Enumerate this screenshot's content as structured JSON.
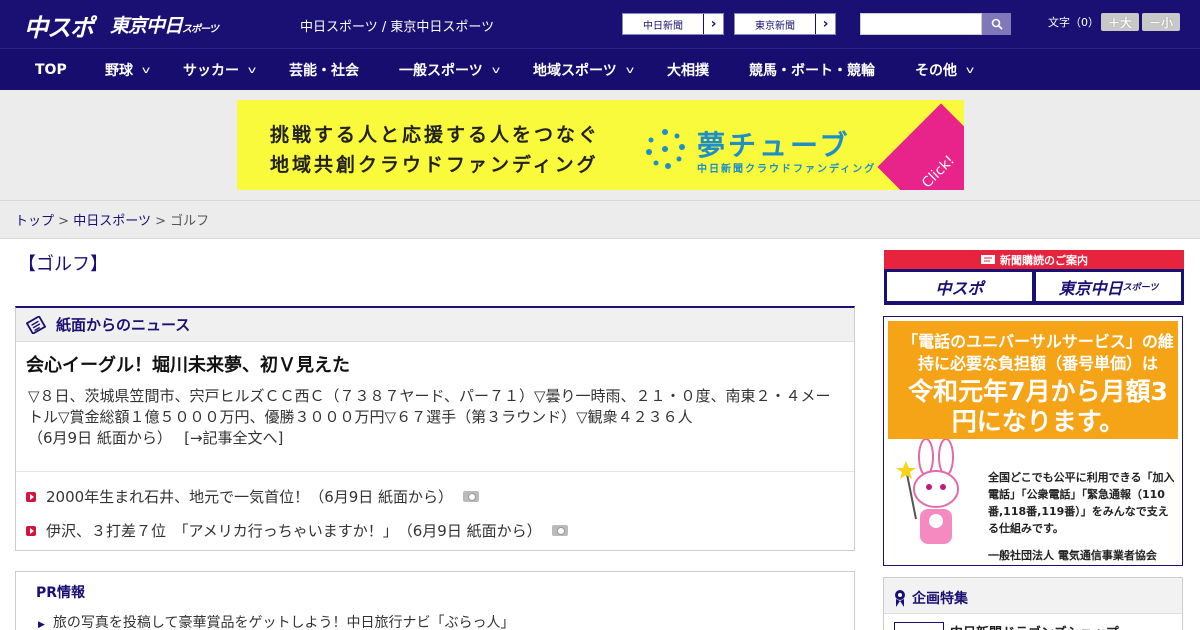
{
  "header": {
    "logo_main": "中スポ",
    "logo_tokyo": "東京中日",
    "logo_tokyo_small": "スポーツ",
    "site_link": "中日スポーツ / 東京中日スポーツ",
    "paper_links": [
      "中日新聞",
      "東京新聞"
    ],
    "search_placeholder": "",
    "font_size_label": "文字（0）",
    "font_bigger": "＋大",
    "font_smaller": "－小"
  },
  "nav": {
    "items": [
      {
        "label": "TOP",
        "has_menu": false
      },
      {
        "label": "野球",
        "has_menu": true
      },
      {
        "label": "サッカー",
        "has_menu": true
      },
      {
        "label": "芸能・社会",
        "has_menu": false
      },
      {
        "label": "一般スポーツ",
        "has_menu": true
      },
      {
        "label": "地域スポーツ",
        "has_menu": true
      },
      {
        "label": "大相撲",
        "has_menu": false
      },
      {
        "label": "競馬・ボート・競輪",
        "has_menu": false
      },
      {
        "label": "その他",
        "has_menu": true
      }
    ]
  },
  "banner": {
    "line1": "挑戦する人と応援する人をつなぐ",
    "line2": "地域共創クラウドファンディング",
    "brand": "夢チューブ",
    "brand_sub": "中日新聞クラウドファンディング",
    "click": "Click!"
  },
  "breadcrumb": {
    "top": "トップ",
    "section": "中日スポーツ",
    "current": "ゴルフ",
    "sep": ">"
  },
  "page": {
    "title": "【ゴルフ】"
  },
  "news": {
    "header": "紙面からのニュース",
    "lead_title": "会心イーグル！堀川未来夢、初Ｖ見えた",
    "lead_body": "▽８日、茨城県笠間市、宍戸ヒルズＣＣ西Ｃ（７３８７ヤード、パー７１）▽曇り一時雨、２１・０度、南東２・４メートル▽賞金総額１億５０００万円、優勝３０００万円▽６７選手（第３ラウンド）▽観衆４２３６人",
    "lead_date": "（6月9日 紙面から）",
    "lead_more": "[→記事全文へ]",
    "items": [
      {
        "title": "2000年生まれ石井、地元で一気首位！",
        "date": "（6月9日 紙面から）"
      },
      {
        "title": "伊沢、３打差７位　「アメリカ行っちゃいますか！」",
        "date": "（6月9日 紙面から）"
      }
    ]
  },
  "pr": {
    "header": "PR情報",
    "items": [
      "旅の写真を投稿して豪華賞品をゲットしよう！中日旅行ナビ「ぶらっ人」"
    ]
  },
  "sidebar": {
    "subscribe": {
      "header": "新聞購読のご案内",
      "buttons": [
        "中スポ",
        "東京中日"
      ],
      "button_small": "スポーツ"
    },
    "universal": {
      "line1": "「電話のユニバーサルサービス」の維持に必要な負担額（番号単価）は",
      "line2": "令和元年7月から月額3円になります。",
      "line3": "全国どこでも公平に利用できる「加入電話」「公衆電話」「緊急通報（110番,118番,119番）」をみんなで支える仕組みです。",
      "org": "一般社団法人 電気通信事業者協会"
    },
    "plan": {
      "header": "企画特集",
      "item": "中日新聞ドラゴンズショップ"
    }
  },
  "colors": {
    "navy": "#1a1073",
    "accent_red": "#d4143c",
    "banner_yellow": "#fafa3c",
    "banner_blue": "#1d8ec7",
    "banner_pink": "#e8238a",
    "universal_orange": "#f6a417"
  }
}
